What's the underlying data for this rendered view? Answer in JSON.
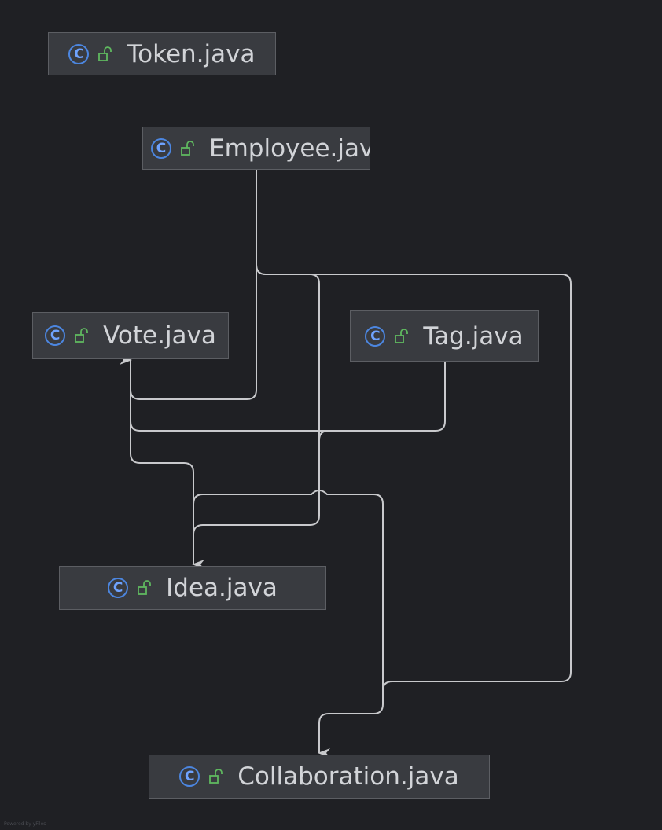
{
  "diagram": {
    "nodes": [
      {
        "id": "token",
        "label": "Token.java",
        "icon": "class-icon",
        "badge": "public-lock-icon"
      },
      {
        "id": "employee",
        "label": "Employee.jav",
        "icon": "class-icon",
        "badge": "public-lock-icon"
      },
      {
        "id": "vote",
        "label": "Vote.java",
        "icon": "class-icon",
        "badge": "public-lock-icon"
      },
      {
        "id": "tag",
        "label": "Tag.java",
        "icon": "class-icon",
        "badge": "public-lock-icon"
      },
      {
        "id": "idea",
        "label": "Idea.java",
        "icon": "class-icon",
        "badge": "public-lock-icon"
      },
      {
        "id": "collaboration",
        "label": "Collaboration.java",
        "icon": "class-icon",
        "badge": "public-lock-icon"
      }
    ],
    "edges": [
      {
        "from": "employee",
        "to": "vote"
      },
      {
        "from": "employee",
        "to": "idea"
      },
      {
        "from": "employee",
        "to": "collaboration"
      },
      {
        "from": "tag",
        "to": "vote"
      },
      {
        "from": "tag",
        "to": "idea"
      },
      {
        "from": "idea",
        "to": "collaboration"
      },
      {
        "from": "vote",
        "to": "idea"
      }
    ],
    "class_icon_glyph": "C",
    "footer": "Powered by yFiles"
  },
  "colors": {
    "background": "#1f2024",
    "node_fill": "#393b40",
    "node_border": "#5c5e63",
    "text": "#d2d4d8",
    "class_icon": "#4c86e0",
    "lock_icon": "#5fb85f",
    "edge": "#c8c9cc"
  }
}
